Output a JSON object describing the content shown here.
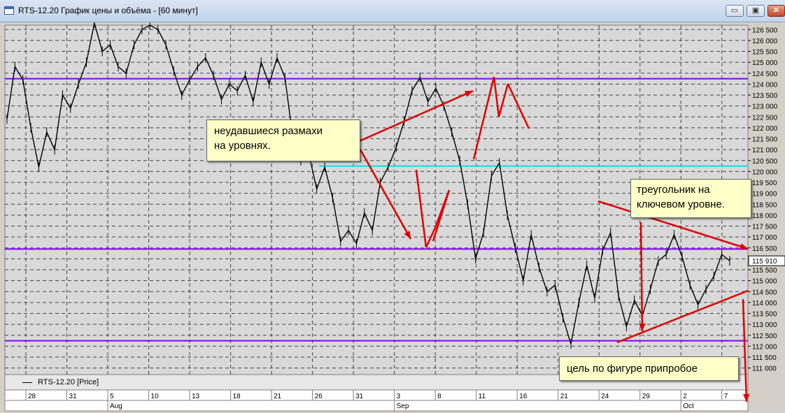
{
  "window": {
    "title": "RTS-12.20 График цены и объёма - [60 минут]",
    "buttons": {
      "minimize": "▭",
      "restore": "▣",
      "close": "✕"
    }
  },
  "legend": {
    "label": "RTS-12.20 [Price]"
  },
  "annotations": [
    {
      "id": "ann-1",
      "lines": [
        "неудавшиеся размахи",
        "на уровнях."
      ]
    },
    {
      "id": "ann-2",
      "lines": [
        "треугольник на",
        "ключевом уровне."
      ]
    },
    {
      "id": "ann-3",
      "lines": [
        "цель по фигуре припробое"
      ]
    }
  ],
  "colors": {
    "plot_bg": "#d9d9d9",
    "price": "#000000",
    "level": "#8000ff",
    "level_cyan": "#00e0f0",
    "arrow": "#e00000",
    "tooltip_bg": "#ffffc8"
  },
  "chart_data": {
    "type": "line",
    "title": "",
    "series": [
      {
        "name": "RTS-12.20 [Price]",
        "points": [
          [
            "Aug 27",
            122400
          ],
          [
            "Aug 28",
            124800
          ],
          [
            "Aug 29",
            124200
          ],
          [
            "Aug 29",
            122000
          ],
          [
            "Aug 30",
            120200
          ],
          [
            "Aug 31",
            121800
          ],
          [
            "Aug 31",
            121000
          ],
          [
            "Sep 1",
            123500
          ],
          [
            "Sep 1",
            122900
          ],
          [
            "Sep 2",
            124000
          ],
          [
            "Sep 3",
            125000
          ],
          [
            "Sep 4",
            126800
          ],
          [
            "Sep 4",
            125500
          ],
          [
            "Sep 5",
            125800
          ],
          [
            "Sep 6",
            124800
          ],
          [
            "Sep 7",
            124500
          ],
          [
            "Sep 8",
            125800
          ],
          [
            "Sep 9",
            126500
          ],
          [
            "Sep 10",
            126700
          ],
          [
            "Sep 18",
            126500
          ],
          [
            "Sep 19",
            125800
          ],
          [
            "Sep 19",
            124600
          ],
          [
            "Sep 20",
            123500
          ],
          [
            "Sep 21",
            124200
          ],
          [
            "Sep 22",
            124800
          ],
          [
            "Sep 23",
            125200
          ],
          [
            "Sep 24",
            124400
          ],
          [
            "Sep 25",
            123300
          ],
          [
            "Sep 26",
            124000
          ],
          [
            "Sep 27",
            123700
          ],
          [
            "Sep 28",
            124400
          ],
          [
            "Sep 29",
            123200
          ],
          [
            "Sep 30",
            125000
          ],
          [
            "Oct 1",
            124000
          ],
          [
            "Oct 2",
            125200
          ],
          [
            "Oct 3",
            124300
          ],
          [
            "Oct 3",
            121500
          ],
          [
            "Oct 4",
            120500
          ],
          [
            "Oct 5",
            120800
          ],
          [
            "Oct 6",
            119200
          ],
          [
            "Oct 6",
            120200
          ],
          [
            "Oct 7",
            118800
          ],
          [
            "Oct 8",
            116800
          ],
          [
            "Oct 8",
            117300
          ],
          [
            "Oct 9",
            116700
          ],
          [
            "Oct 10",
            118100
          ],
          [
            "Oct 11",
            117300
          ],
          [
            "Oct 11",
            119500
          ],
          [
            "Oct 12",
            120200
          ],
          [
            "Oct 13",
            121100
          ],
          [
            "Oct 14",
            122300
          ],
          [
            "Oct 15",
            123700
          ],
          [
            "Oct 16",
            124300
          ],
          [
            "Oct 17",
            123200
          ],
          [
            "Oct 18",
            123800
          ],
          [
            "Oct 18",
            123000
          ],
          [
            "Oct 19",
            121800
          ],
          [
            "Oct 20",
            120500
          ],
          [
            "Oct 21",
            118500
          ],
          [
            "Oct 21",
            116000
          ],
          [
            "Oct 22",
            117200
          ],
          [
            "Oct 23",
            119800
          ],
          [
            "Oct 23",
            120400
          ],
          [
            "Oct 24",
            118000
          ],
          [
            "Oct 25",
            116500
          ],
          [
            "Oct 26",
            115000
          ],
          [
            "Oct 27",
            117100
          ],
          [
            "Oct 27",
            115600
          ],
          [
            "Oct 28",
            114500
          ],
          [
            "Oct 29",
            114800
          ],
          [
            "Oct 30",
            113300
          ],
          [
            "Oct 30",
            112100
          ],
          [
            "Oct 31",
            114000
          ],
          [
            "Nov 1",
            115700
          ],
          [
            "Nov 2",
            114200
          ],
          [
            "Nov 2",
            116400
          ],
          [
            "Nov 3",
            117200
          ],
          [
            "Nov 3",
            114300
          ],
          [
            "Nov 4",
            112900
          ],
          [
            "Nov 5",
            114100
          ],
          [
            "Nov 6",
            113400
          ],
          [
            "Nov 7",
            114600
          ],
          [
            "Nov 7",
            115900
          ],
          [
            "Nov 8",
            116200
          ],
          [
            "Nov 9",
            117100
          ],
          [
            "Nov 9",
            116100
          ],
          [
            "Nov 10",
            114800
          ],
          [
            "Nov 11",
            113900
          ],
          [
            "Nov 12",
            114600
          ],
          [
            "Nov 12",
            115200
          ],
          [
            "Nov 13",
            116200
          ],
          [
            "Nov 14",
            115910
          ]
        ]
      }
    ],
    "last_price": "115 910",
    "y_ticks": [
      "111 000",
      "111 500",
      "112 000",
      "112 500",
      "113 000",
      "113 500",
      "114 000",
      "114 500",
      "115 000",
      "115 500",
      "116 000",
      "116 500",
      "117 000",
      "117 500",
      "118 000",
      "118 500",
      "119 000",
      "119 500",
      "120 000",
      "120 500",
      "121 000",
      "121 500",
      "122 000",
      "122 500",
      "123 000",
      "123 500",
      "124 000",
      "124 500",
      "125 000",
      "125 500",
      "126 000",
      "126 500"
    ],
    "ylim": [
      110700,
      126700
    ],
    "x_ticks": [
      "28",
      "31",
      "5",
      "10",
      "13",
      "18",
      "21",
      "26",
      "31",
      "3",
      "8",
      "11",
      "16",
      "21",
      "24",
      "29",
      "2",
      "7"
    ],
    "x_month_labels": [
      {
        "label": "Aug",
        "at": "5"
      },
      {
        "label": "Sep",
        "at": "3"
      },
      {
        "label": "Oct",
        "at": "2"
      }
    ],
    "levels": [
      {
        "value": 124250,
        "color": "#8000ff"
      },
      {
        "value": 116450,
        "color": "#8000ff"
      },
      {
        "value": 112250,
        "color": "#8000ff"
      },
      {
        "value": 120250,
        "color": "#00e0f0",
        "from": "Oct 6"
      }
    ],
    "grid": true
  }
}
